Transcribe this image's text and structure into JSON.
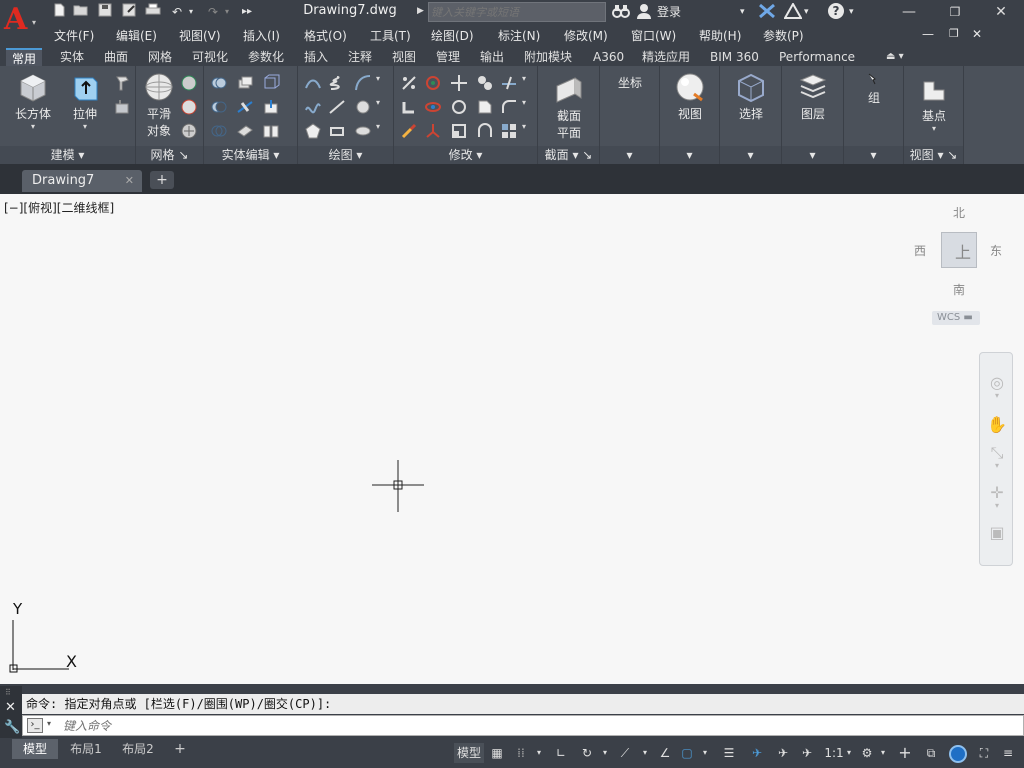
{
  "app": {
    "logo_letter": "A"
  },
  "title_bar": {
    "document_title": "Drawing7.dwg",
    "search_placeholder": "键入关键字或短语",
    "login_label": "登录",
    "help_icon": "?"
  },
  "menu": [
    "文件(F)",
    "编辑(E)",
    "视图(V)",
    "插入(I)",
    "格式(O)",
    "工具(T)",
    "绘图(D)",
    "标注(N)",
    "修改(M)",
    "窗口(W)",
    "帮助(H)",
    "参数(P)"
  ],
  "ribbon_tabs": [
    "常用",
    "实体",
    "曲面",
    "网格",
    "可视化",
    "参数化",
    "插入",
    "注释",
    "视图",
    "管理",
    "输出",
    "附加模块",
    "A360",
    "精选应用",
    "BIM 360",
    "Performance"
  ],
  "ribbon": {
    "modeling": {
      "label": "建模",
      "box": "长方体",
      "extrude": "拉伸"
    },
    "mesh": {
      "label": "网格",
      "smooth_1": "平滑",
      "smooth_2": "对象"
    },
    "solid_edit": {
      "label": "实体编辑"
    },
    "draw": {
      "label": "绘图"
    },
    "modify": {
      "label": "修改"
    },
    "section": {
      "label": "截面",
      "plane_1": "截面",
      "plane_2": "平面"
    },
    "coords": {
      "label": "坐标"
    },
    "view_btn": "视图",
    "select_btn": "选择",
    "layers_btn": "图层",
    "group_btn": "组",
    "view_panel": {
      "label": "视图",
      "base": "基点"
    }
  },
  "file_tab": {
    "name": "Drawing7"
  },
  "viewport": {
    "label": "[−][俯视][二维线框]",
    "compass": {
      "north": "北",
      "south": "南",
      "east": "东",
      "west": "西"
    },
    "cube_face": "上",
    "wcs": "WCS",
    "ucs_x": "X",
    "ucs_y": "Y"
  },
  "command": {
    "history": "命令: 指定对角点或 [栏选(F)/圈围(WP)/圈交(CP)]:",
    "placeholder": "键入命令"
  },
  "layouts": [
    "模型",
    "布局1",
    "布局2"
  ],
  "status": {
    "model_label": "模型",
    "scale": "1:1"
  },
  "colors": {
    "accent_blue": "#4c9ad6",
    "logo_red": "#e02a20",
    "canvas_bg": "#f7f7f7"
  }
}
